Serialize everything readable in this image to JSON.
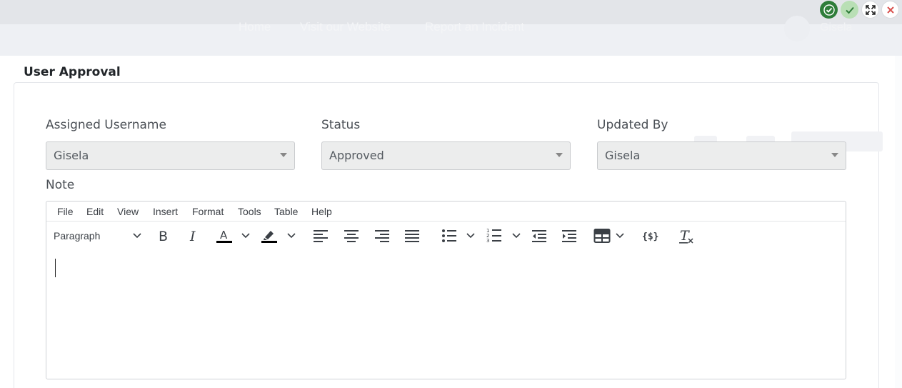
{
  "background": {
    "nav_items": [
      "Home",
      "Visit our Website",
      "Report an Incident"
    ],
    "user_name": "Gisela"
  },
  "modal": {
    "title": "User Approval",
    "fields": {
      "assigned_username": {
        "label": "Assigned Username",
        "value": "Gisela"
      },
      "status": {
        "label": "Status",
        "value": "Approved"
      },
      "updated_by": {
        "label": "Updated By",
        "value": "Gisela"
      },
      "note": {
        "label": "Note"
      }
    }
  },
  "editor": {
    "menu": [
      "File",
      "Edit",
      "View",
      "Insert",
      "Format",
      "Tools",
      "Table",
      "Help"
    ],
    "block_format": "Paragraph",
    "text_color": "#000000",
    "highlight_color": "#000000"
  },
  "window_controls": [
    "save-check-icon",
    "approve-check-icon",
    "expand-icon",
    "close-icon"
  ],
  "colors": {
    "approve_green": "#2f7d3a",
    "approve_light_green": "#b9dfb5",
    "close_red": "#d9534f"
  }
}
